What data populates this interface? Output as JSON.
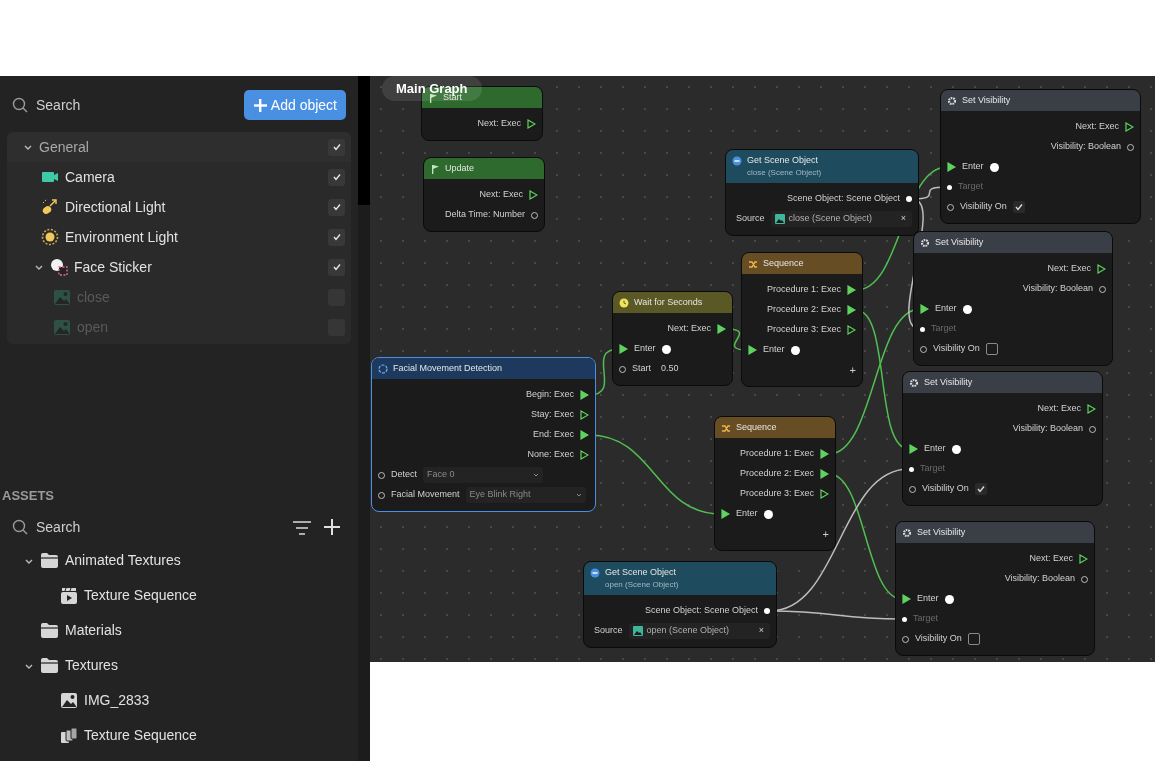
{
  "hierarchy": {
    "search": {
      "placeholder": "Search"
    },
    "add_button": {
      "label": "Add object"
    },
    "items": [
      {
        "label": "General",
        "kind": "group",
        "expanded": true,
        "visible": true,
        "disabled": false,
        "children": [
          {
            "label": "Camera",
            "kind": "camera",
            "visible": true,
            "disabled": false
          },
          {
            "label": "Directional Light",
            "kind": "directional_light",
            "visible": true,
            "disabled": false
          },
          {
            "label": "Environment Light",
            "kind": "environment_light",
            "visible": true,
            "disabled": false
          },
          {
            "label": "Face Sticker",
            "kind": "face_sticker",
            "expanded": true,
            "visible": true,
            "disabled": false,
            "children": [
              {
                "label": "close",
                "kind": "image",
                "visible": false,
                "disabled": true
              },
              {
                "label": "open",
                "kind": "image",
                "visible": false,
                "disabled": true
              }
            ]
          }
        ]
      }
    ]
  },
  "assets": {
    "title": "ASSETS",
    "search": {
      "placeholder": "Search"
    },
    "items": [
      {
        "label": "Animated Textures",
        "kind": "folder",
        "expanded": true,
        "children": [
          {
            "label": "Texture Sequence",
            "kind": "animated_texture"
          }
        ]
      },
      {
        "label": "Materials",
        "kind": "folder"
      },
      {
        "label": "Textures",
        "kind": "folder",
        "expanded": true,
        "children": [
          {
            "label": "IMG_2833",
            "kind": "image"
          },
          {
            "label": "Texture Sequence",
            "kind": "texture_sequence"
          }
        ]
      }
    ]
  },
  "graph": {
    "title": "Main Graph",
    "nodes": [
      {
        "title": "Start",
        "kind": "event",
        "selected": false,
        "rows": [
          {
            "kind": "out_exec",
            "label": "Next: Exec",
            "connected": false
          }
        ]
      },
      {
        "title": "Update",
        "kind": "event",
        "selected": false,
        "rows": [
          {
            "kind": "out_exec",
            "label": "Next: Exec",
            "connected": false
          },
          {
            "kind": "out_data",
            "label": "Delta Time: Number",
            "connected": false
          }
        ]
      },
      {
        "title": "Get Scene Object",
        "subtitle": "close (Scene Object)",
        "kind": "object",
        "selected": false,
        "rows": [
          {
            "kind": "out_data",
            "label": "Scene Object: Scene Object",
            "connected": true
          },
          {
            "kind": "source",
            "label": "Source",
            "value": "close (Scene Object)",
            "clear": "×"
          }
        ]
      },
      {
        "title": "Set Visibility",
        "kind": "action",
        "selected": false,
        "rows": [
          {
            "kind": "out_exec",
            "label": "Next: Exec",
            "connected": false
          },
          {
            "kind": "out_data",
            "label": "Visibility: Boolean",
            "connected": false
          },
          {
            "kind": "enter",
            "label": "Enter",
            "connected": true
          },
          {
            "kind": "target",
            "label": "Target",
            "connected": true
          },
          {
            "kind": "toggle",
            "label": "Visibility On",
            "checked": true
          }
        ]
      },
      {
        "title": "Wait for Seconds",
        "kind": "wait",
        "selected": false,
        "rows": [
          {
            "kind": "out_exec",
            "label": "Next: Exec",
            "connected": true
          },
          {
            "kind": "enter",
            "label": "Enter",
            "connected": true
          },
          {
            "kind": "number",
            "label": "Start",
            "value": "0.50"
          }
        ]
      },
      {
        "title": "Sequence",
        "kind": "sequence",
        "selected": false,
        "rows": [
          {
            "kind": "out_exec",
            "label": "Procedure 1: Exec",
            "connected": true
          },
          {
            "kind": "out_exec",
            "label": "Procedure 2: Exec",
            "connected": true
          },
          {
            "kind": "out_exec",
            "label": "Procedure 3: Exec",
            "connected": false
          },
          {
            "kind": "enter",
            "label": "Enter",
            "connected": true
          },
          {
            "kind": "add",
            "label": "+"
          }
        ]
      },
      {
        "title": "Set Visibility",
        "kind": "action",
        "selected": false,
        "rows": [
          {
            "kind": "out_exec",
            "label": "Next: Exec",
            "connected": false
          },
          {
            "kind": "out_data",
            "label": "Visibility: Boolean",
            "connected": false
          },
          {
            "kind": "enter",
            "label": "Enter",
            "connected": true
          },
          {
            "kind": "target",
            "label": "Target",
            "connected": true
          },
          {
            "kind": "toggle",
            "label": "Visibility On",
            "checked": false
          }
        ]
      },
      {
        "title": "Facial Movement Detection",
        "kind": "detection",
        "selected": true,
        "rows": [
          {
            "kind": "out_exec",
            "label": "Begin: Exec",
            "connected": true
          },
          {
            "kind": "out_exec",
            "label": "Stay: Exec",
            "connected": false
          },
          {
            "kind": "out_exec",
            "label": "End: Exec",
            "connected": true
          },
          {
            "kind": "out_exec",
            "label": "None: Exec",
            "connected": false
          },
          {
            "kind": "select",
            "label": "Detect",
            "value": "Face 0"
          },
          {
            "kind": "select",
            "label": "Facial Movement",
            "value": "Eye Blink Right"
          }
        ]
      },
      {
        "title": "Sequence",
        "kind": "sequence",
        "selected": false,
        "rows": [
          {
            "kind": "out_exec",
            "label": "Procedure 1: Exec",
            "connected": true
          },
          {
            "kind": "out_exec",
            "label": "Procedure 2: Exec",
            "connected": true
          },
          {
            "kind": "out_exec",
            "label": "Procedure 3: Exec",
            "connected": false
          },
          {
            "kind": "enter",
            "label": "Enter",
            "connected": true
          },
          {
            "kind": "add",
            "label": "+"
          }
        ]
      },
      {
        "title": "Set Visibility",
        "kind": "action",
        "selected": false,
        "rows": [
          {
            "kind": "out_exec",
            "label": "Next: Exec",
            "connected": false
          },
          {
            "kind": "out_data",
            "label": "Visibility: Boolean",
            "connected": false
          },
          {
            "kind": "enter",
            "label": "Enter",
            "connected": true
          },
          {
            "kind": "target",
            "label": "Target",
            "connected": true
          },
          {
            "kind": "toggle",
            "label": "Visibility On",
            "checked": true
          }
        ]
      },
      {
        "title": "Get Scene Object",
        "subtitle": "open (Scene Object)",
        "kind": "object",
        "selected": false,
        "rows": [
          {
            "kind": "out_data",
            "label": "Scene Object: Scene Object",
            "connected": true
          },
          {
            "kind": "source",
            "label": "Source",
            "value": "open (Scene Object)",
            "clear": "×"
          }
        ]
      },
      {
        "title": "Set Visibility",
        "kind": "action",
        "selected": false,
        "rows": [
          {
            "kind": "out_exec",
            "label": "Next: Exec",
            "connected": false
          },
          {
            "kind": "out_data",
            "label": "Visibility: Boolean",
            "connected": false
          },
          {
            "kind": "enter",
            "label": "Enter",
            "connected": true
          },
          {
            "kind": "target",
            "label": "Target",
            "connected": true
          },
          {
            "kind": "toggle",
            "label": "Visibility On",
            "checked": false
          }
        ]
      }
    ]
  }
}
